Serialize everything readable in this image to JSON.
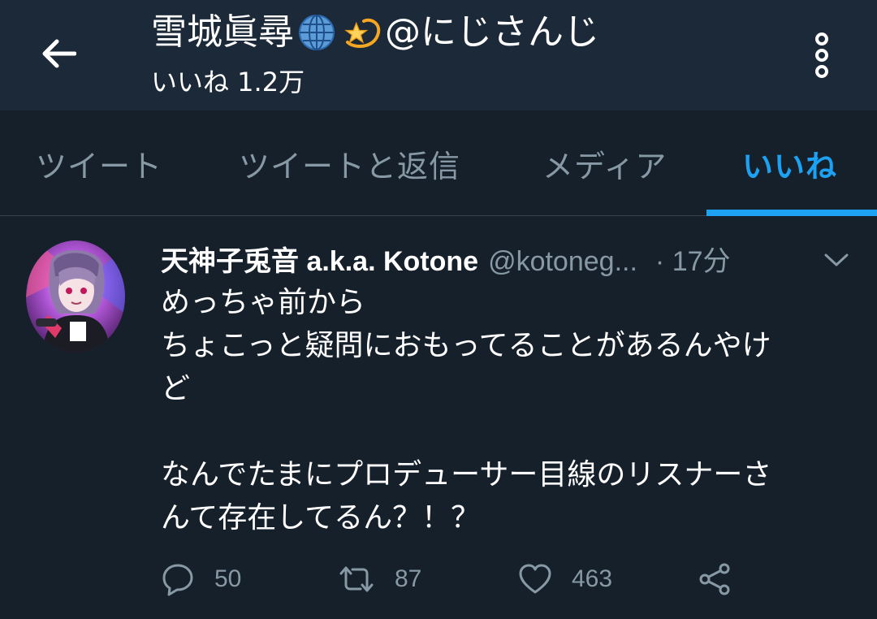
{
  "header": {
    "name": "雪城眞尋",
    "emoji_1": "globe-icon",
    "emoji_2": "dizzy-star-icon",
    "name_suffix": "@にじさんじ",
    "subtitle": "いいね 1.2万"
  },
  "tabs": [
    {
      "label": "ツイート",
      "active": false
    },
    {
      "label": "ツイートと返信",
      "active": false
    },
    {
      "label": "メディア",
      "active": false
    },
    {
      "label": "いいね",
      "active": true
    }
  ],
  "tweet": {
    "author_name": "天神子兎音 a.k.a. Kotone",
    "author_handle": "@kotoneg...",
    "time": "· 17分",
    "lines": [
      "めっちゃ前から",
      "ちょこっと疑問におもってることがあるんやけ",
      "ど",
      "",
      "なんでたまにプロデューサー目線のリスナーさ",
      "んて存在してるん？！？"
    ],
    "replies": "50",
    "retweets": "87",
    "likes": "463"
  },
  "colors": {
    "background": "#15202b",
    "header_bg": "#1c2938",
    "accent": "#1da1f2",
    "muted": "#8899a6"
  }
}
